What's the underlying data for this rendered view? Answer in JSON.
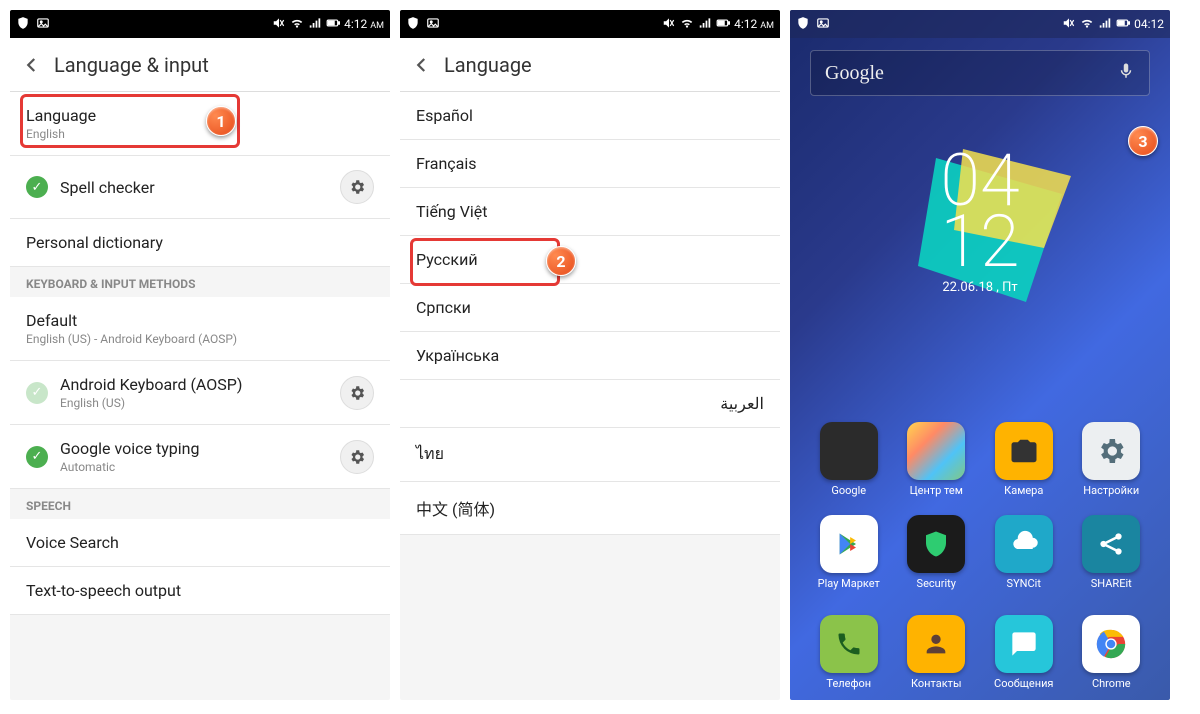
{
  "statusbar": {
    "time12": "4:12",
    "ampm": "AM",
    "time24": "04:12"
  },
  "phone1": {
    "header_title": "Language & input",
    "language_label": "Language",
    "language_value": "English",
    "spell_checker": "Spell checker",
    "personal_dictionary": "Personal dictionary",
    "section_keyboard": "KEYBOARD & INPUT METHODS",
    "default_label": "Default",
    "default_sub": "English (US) - Android Keyboard (AOSP)",
    "aosp_label": "Android Keyboard (AOSP)",
    "aosp_sub": "English (US)",
    "gvoice_label": "Google voice typing",
    "gvoice_sub": "Automatic",
    "section_speech": "SPEECH",
    "voice_search": "Voice Search",
    "tts": "Text-to-speech output",
    "step": "1"
  },
  "phone2": {
    "header_title": "Language",
    "langs": [
      "Español",
      "Français",
      "Tiếng Việt",
      "Русский",
      "Српски",
      "Українська",
      "العربية",
      "ไทย",
      "中文 (简体)"
    ],
    "step": "2"
  },
  "phone3": {
    "search_label": "Google",
    "clock_hh": "04",
    "clock_mm": "12",
    "date": "22.06.18 , Пт",
    "apps_row1": [
      "Google",
      "Центр тем",
      "Камера",
      "Настройки"
    ],
    "apps_row2": [
      "Play Маркет",
      "Security",
      "SYNCit",
      "SHAREit"
    ],
    "dock": [
      "Телефон",
      "Контакты",
      "Сообщения",
      "Chrome"
    ],
    "step": "3"
  }
}
